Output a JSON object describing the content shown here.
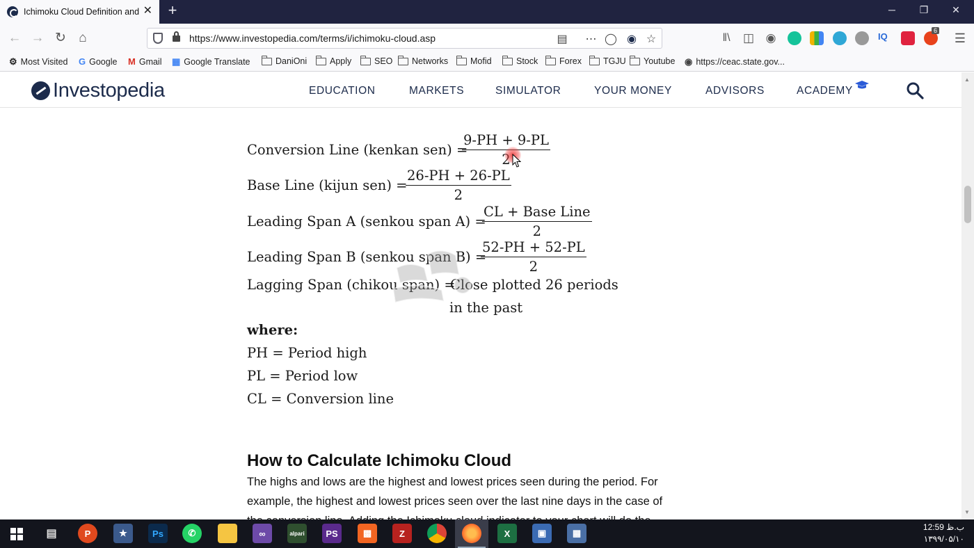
{
  "browser": {
    "tab_title": "Ichimoku Cloud Definition and",
    "tab_close": "✕",
    "new_tab": "+",
    "window_controls": {
      "minimize": "─",
      "restore": "❐",
      "close": "✕"
    },
    "url": "https://www.investopedia.com/terms/i/ichimoku-cloud.asp",
    "notification_count": "6"
  },
  "bookmarks": [
    {
      "label": "Most Visited",
      "icon": "gear-icon"
    },
    {
      "label": "Google",
      "icon": "google-icon"
    },
    {
      "label": "Gmail",
      "icon": "gmail-icon"
    },
    {
      "label": "Google Translate",
      "icon": "translate-icon"
    },
    {
      "label": "DaniOni",
      "icon": "folder-icon"
    },
    {
      "label": "Apply",
      "icon": "folder-icon"
    },
    {
      "label": "SEO",
      "icon": "folder-icon"
    },
    {
      "label": "Networks",
      "icon": "folder-icon"
    },
    {
      "label": "Mofid",
      "icon": "folder-icon"
    },
    {
      "label": "Stock",
      "icon": "folder-icon"
    },
    {
      "label": "Forex",
      "icon": "folder-icon"
    },
    {
      "label": "TGJU",
      "icon": "folder-icon"
    },
    {
      "label": "Youtube",
      "icon": "folder-icon"
    },
    {
      "label": "https://ceac.state.gov...",
      "icon": "seal-icon"
    }
  ],
  "site": {
    "logo": "Investopedia",
    "menu": [
      "EDUCATION",
      "MARKETS",
      "SIMULATOR",
      "YOUR MONEY",
      "ADVISORS",
      "ACADEMY"
    ]
  },
  "formulas": {
    "conversion": {
      "label": "Conversion Line (kenkan sen) =",
      "num": "9-PH + 9-PL",
      "den": "2"
    },
    "base": {
      "label": "Base Line (kijun sen) =",
      "num": "26-PH + 26-PL",
      "den": "2"
    },
    "span_a": {
      "label": "Leading Span A (senkou span A) =",
      "num": "CL + Base Line",
      "den": "2"
    },
    "span_b": {
      "label": "Leading Span B (senkou span B) =",
      "num": "52-PH + 52-PL",
      "den": "2"
    },
    "lagging": {
      "label": "Lagging Span (chikou span) =",
      "value1": "Close plotted 26 periods",
      "value2": "in the past"
    },
    "where": "where:",
    "defs": [
      "PH = Period high",
      "PL = Period low",
      "CL = Conversion line"
    ]
  },
  "article": {
    "heading": "How to Calculate Ichimoku Cloud",
    "paragraph": "The highs and lows are the highest and lowest prices seen during the period. For example, the highest and lowest prices seen over the last nine days in the case of the conversion line. Adding the Ichimoku cloud indicator to your chart will do the"
  },
  "taskbar": {
    "clock_time": "12:59 ب.ظ",
    "clock_date": "۱۳۹۹/۰۵/۱۰"
  }
}
